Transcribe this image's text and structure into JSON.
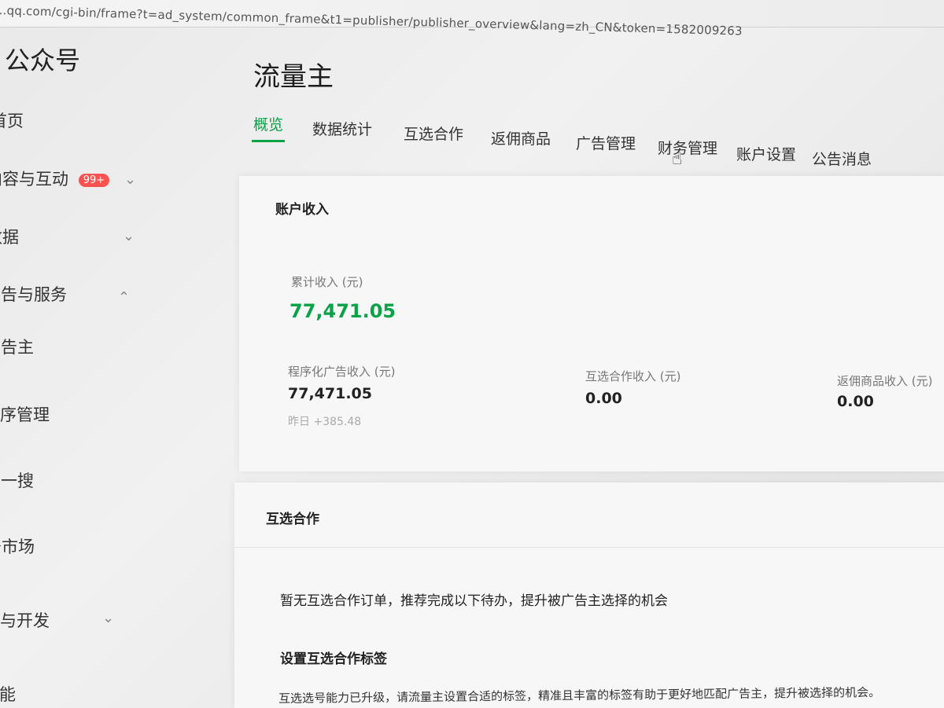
{
  "browser": {
    "url": "...qq.com/cgi-bin/frame?t=ad_system/common_frame&t1=publisher/publisher_overview&lang=zh_CN&token=1582009263"
  },
  "sidebar": {
    "brand": "公众号",
    "items": [
      {
        "label": "首页"
      },
      {
        "label": "内容与互动",
        "badge": "99+"
      },
      {
        "label": "数据"
      },
      {
        "label": "广告与服务"
      },
      {
        "label": "广告主"
      },
      {
        "label": "小程序管理"
      },
      {
        "label": "搜一搜"
      },
      {
        "label": "服务市场"
      },
      {
        "label": "设置与开发"
      },
      {
        "label": "新的功能"
      }
    ]
  },
  "main": {
    "title": "流量主",
    "tabs": [
      "概览",
      "数据统计",
      "互选合作",
      "返佣商品",
      "广告管理",
      "财务管理",
      "账户设置",
      "公告消息"
    ],
    "active_tab": "概览"
  },
  "account_income": {
    "title": "账户收入",
    "total_label": "累计收入 (元)",
    "total_value": "77,471.05",
    "programmatic_label": "程序化广告收入 (元)",
    "programmatic_value": "77,471.05",
    "programmatic_yesterday": "昨日 +385.48",
    "mutual_label": "互选合作收入 (元)",
    "mutual_value": "0.00",
    "commission_label": "返佣商品收入 (元)",
    "commission_value": "0.00"
  },
  "mutual_section": {
    "title": "互选合作",
    "empty_text": "暂无互选合作订单，推荐完成以下待办，提升被广告主选择的机会",
    "tag_heading": "设置互选合作标签",
    "tag_desc": "互选选号能力已升级，请流量主设置合适的标签，精准且丰富的标签有助于更好地匹配广告主，提升被选择的机会。"
  },
  "colors": {
    "accent": "#07a346",
    "badge": "#fa5151"
  }
}
